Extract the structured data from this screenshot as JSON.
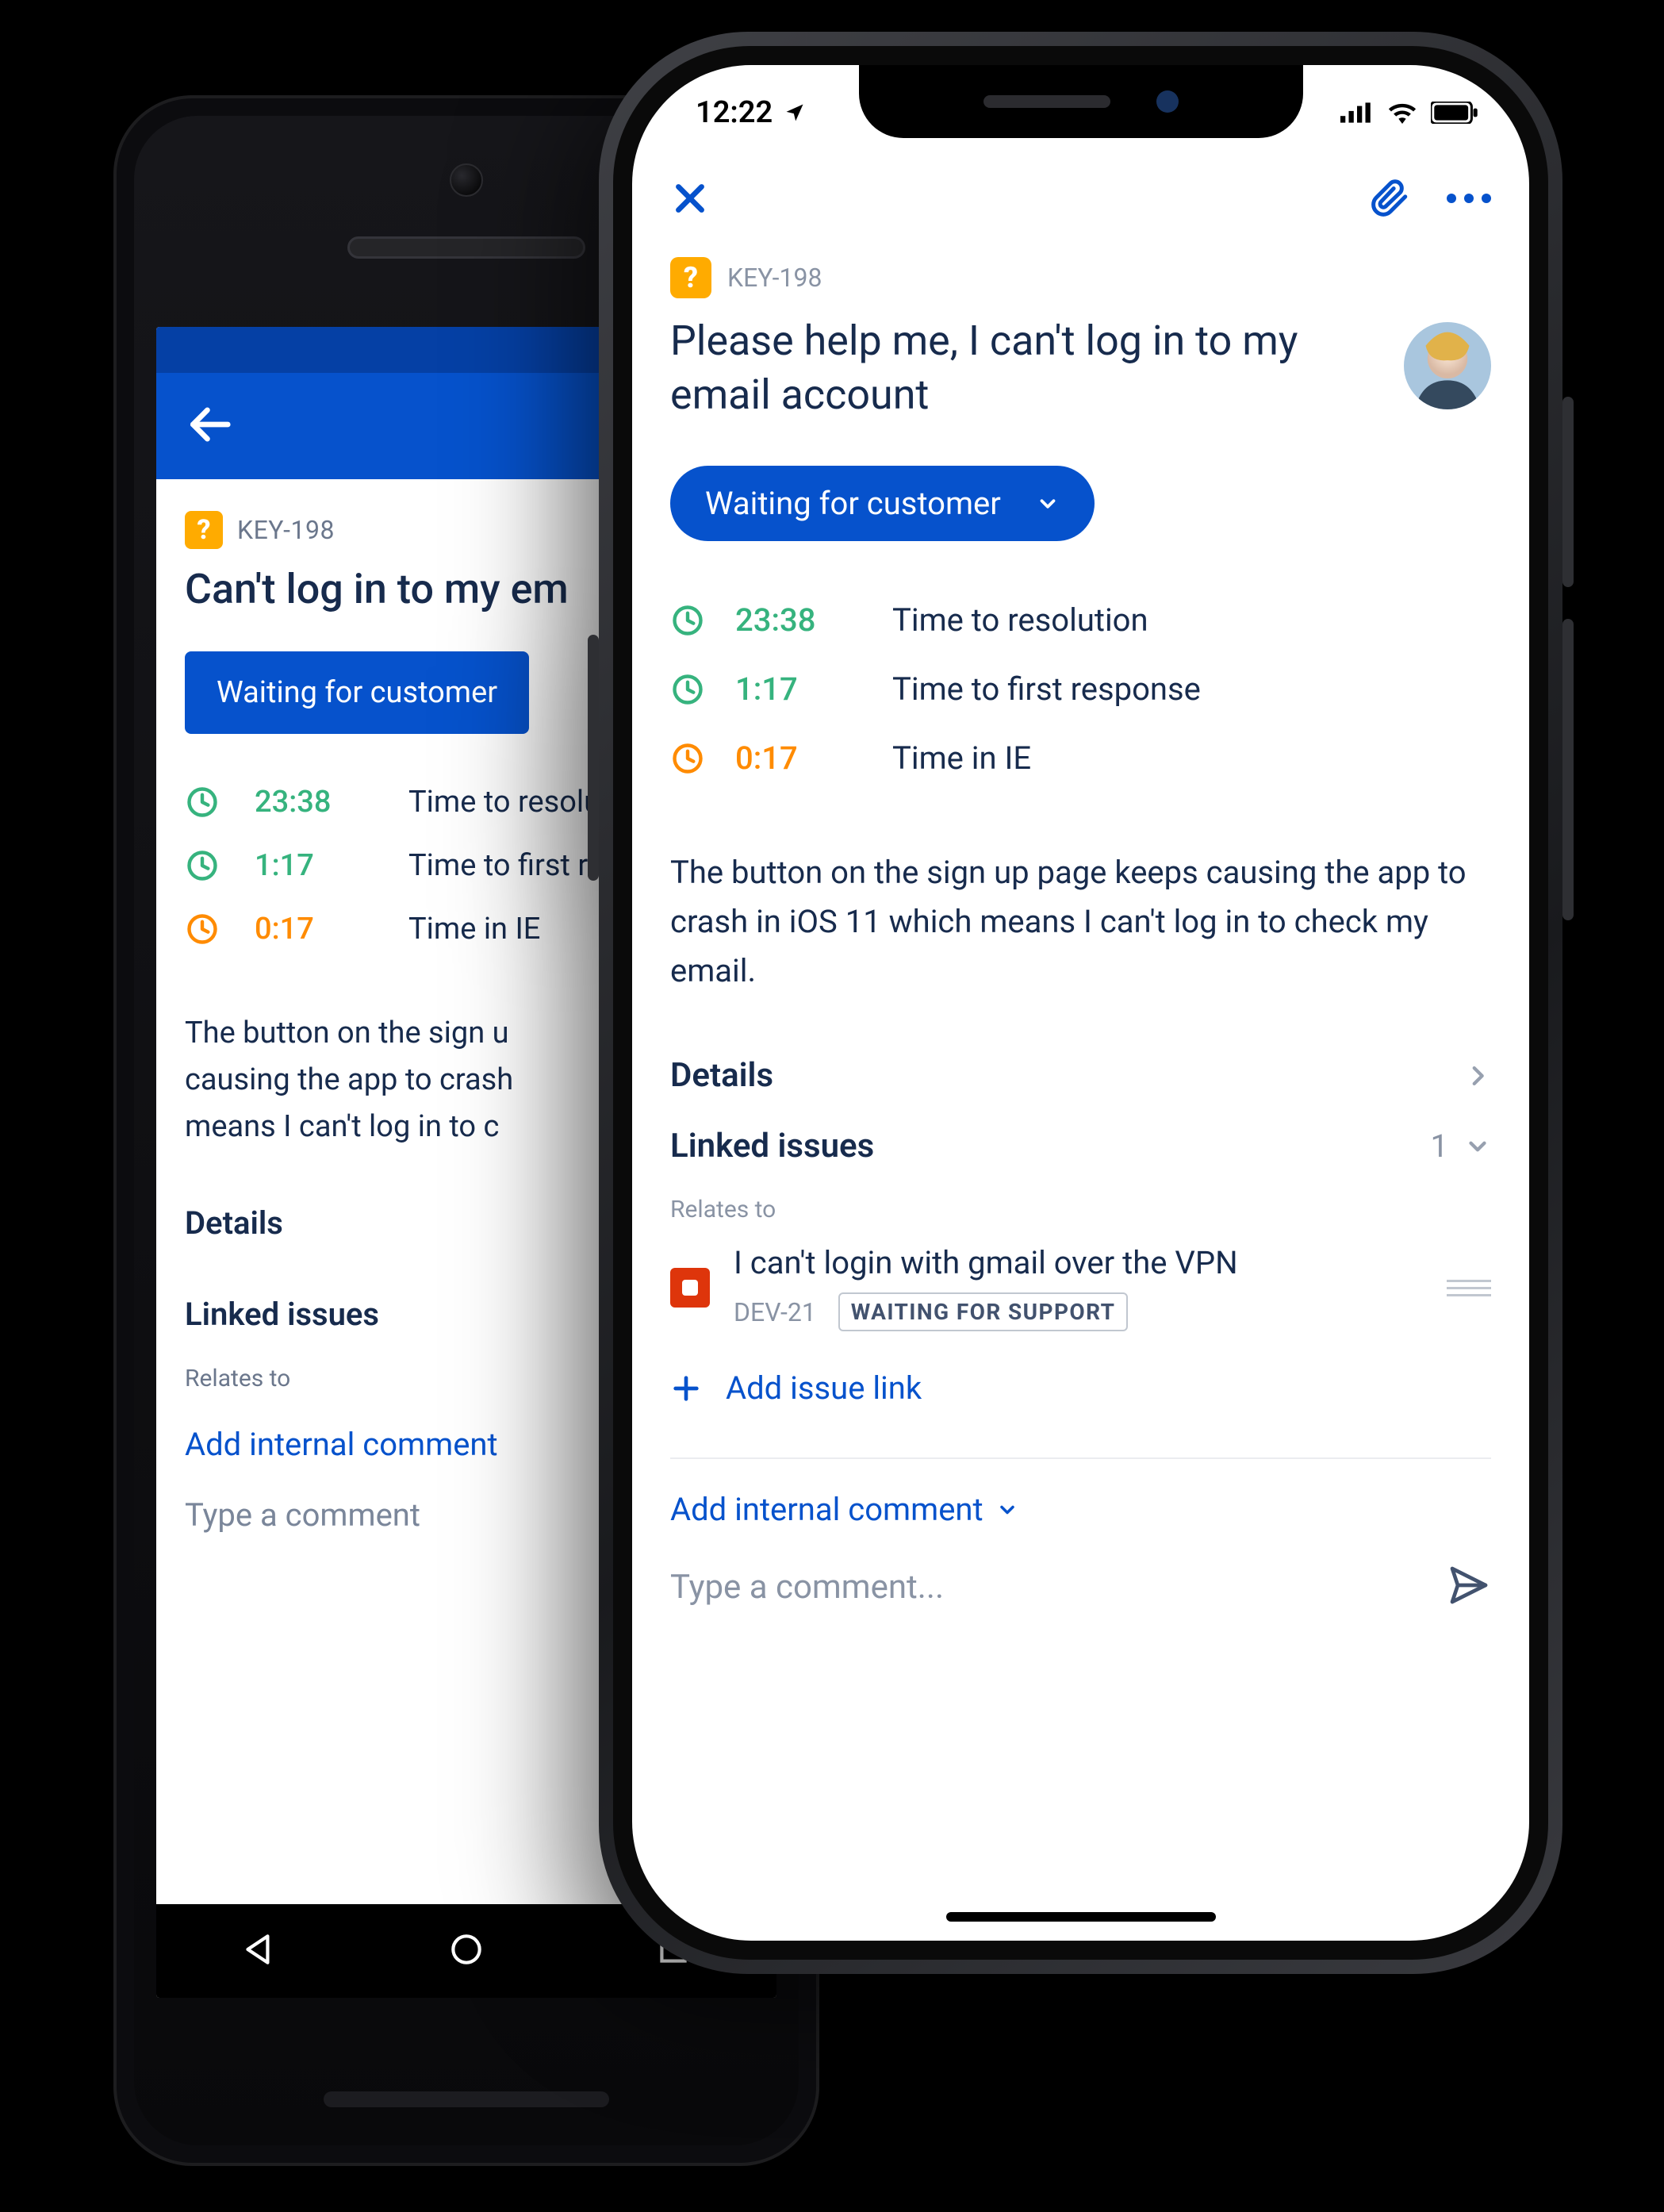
{
  "colors": {
    "accent": "#0652cc",
    "green": "#36b37e",
    "orange": "#ff8b00",
    "warn_badge": "#ffab00",
    "danger": "#de350b"
  },
  "android": {
    "issue_key": "KEY-198",
    "title": "Can't log in to my em",
    "status_label": "Waiting for customer",
    "slas": [
      {
        "icon": "clock-icon",
        "color": "green",
        "time": "23:38",
        "label": "Time to resolu"
      },
      {
        "icon": "clock-icon",
        "color": "green",
        "time": "1:17",
        "label": "Time to first re"
      },
      {
        "icon": "clock-icon",
        "color": "orange",
        "time": "0:17",
        "label": "Time in IE"
      }
    ],
    "description": "The button on the sign u\ncausing the app to crash\nmeans I can't log in to c",
    "sections": {
      "details": "Details",
      "linked": "Linked issues"
    },
    "relates_label": "Relates to",
    "add_internal": "Add internal comment",
    "comment_placeholder": "Type a comment"
  },
  "iphone": {
    "status_time": "12:22",
    "issue_key": "KEY-198",
    "title": "Please help me, I can't log in to my email account",
    "status_label": "Waiting for customer",
    "slas": [
      {
        "icon": "clock-icon",
        "color": "green",
        "time": "23:38",
        "label": "Time to resolution"
      },
      {
        "icon": "clock-icon",
        "color": "green",
        "time": "1:17",
        "label": "Time to first response"
      },
      {
        "icon": "clock-icon",
        "color": "orange",
        "time": "0:17",
        "label": "Time in IE"
      }
    ],
    "description": "The button on the sign up page keeps causing the app to crash in iOS 11 which means I can't log in to check my email.",
    "sections": {
      "details": "Details",
      "linked": "Linked issues",
      "linked_count": "1"
    },
    "relates_label": "Relates to",
    "linked": {
      "title": "I can't login with gmail over the VPN",
      "key": "DEV-21",
      "status": "WAITING FOR SUPPORT"
    },
    "add_link": "Add issue link",
    "add_internal": "Add internal comment",
    "comment_placeholder": "Type a comment..."
  }
}
